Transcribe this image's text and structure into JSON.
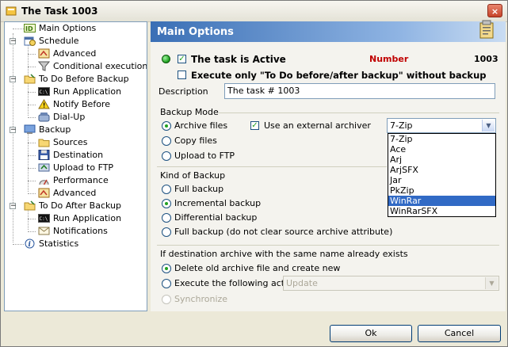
{
  "window": {
    "title": "The Task 1003",
    "close_glyph": "×"
  },
  "tree": {
    "items": [
      {
        "label": "Main Options",
        "icon": "id-card-icon"
      },
      {
        "label": "Schedule",
        "icon": "schedule-icon"
      },
      {
        "label": "Advanced",
        "icon": "advanced-icon"
      },
      {
        "label": "Conditional execution",
        "icon": "filter-icon"
      },
      {
        "label": "To Do Before Backup",
        "icon": "folder-icon"
      },
      {
        "label": "Run Application",
        "icon": "console-icon"
      },
      {
        "label": "Notify Before",
        "icon": "warning-icon"
      },
      {
        "label": "Dial-Up",
        "icon": "phone-icon"
      },
      {
        "label": "Backup",
        "icon": "backup-icon"
      },
      {
        "label": "Sources",
        "icon": "folder-icon"
      },
      {
        "label": "Destination",
        "icon": "disk-icon"
      },
      {
        "label": "Upload to FTP",
        "icon": "ftp-icon"
      },
      {
        "label": "Performance",
        "icon": "performance-icon"
      },
      {
        "label": "Advanced",
        "icon": "advanced-icon"
      },
      {
        "label": "To Do After Backup",
        "icon": "folder-icon"
      },
      {
        "label": "Run Application",
        "icon": "console-icon"
      },
      {
        "label": "Notifications",
        "icon": "mail-icon"
      },
      {
        "label": "Statistics",
        "icon": "info-icon"
      }
    ],
    "expanders": [
      "−",
      "−",
      "−",
      "−",
      "−"
    ]
  },
  "panel": {
    "header": "Main Options",
    "task_active_label": "The task is Active",
    "number_label": "Number",
    "number_value": "1003",
    "execute_only_label": "Execute only \"To Do before/after backup\" without backup",
    "description_label": "Description",
    "description_value": "The task # 1003",
    "backup_mode": {
      "title": "Backup Mode",
      "archive_files": "Archive files",
      "use_external": "Use an external archiver",
      "copy_files": "Copy files",
      "upload_ftp": "Upload to FTP",
      "archiver_selected": "7-Zip",
      "archiver_options": [
        "7-Zip",
        "Ace",
        "Arj",
        "ArjSFX",
        "Jar",
        "PkZip",
        "WinRar",
        "WinRarSFX"
      ]
    },
    "kind": {
      "title": "Kind of Backup",
      "options": [
        "Full backup",
        "Incremental backup",
        "Differential backup",
        "Full backup (do not clear source archive attribute)"
      ]
    },
    "existing": {
      "title": "If destination archive with the same name already exists",
      "delete_old": "Delete old archive file and create new",
      "execute_action": "Execute the following action",
      "action_value": "Update",
      "synchronize": "Synchronize"
    }
  },
  "buttons": {
    "ok": "Ok",
    "cancel": "Cancel"
  },
  "colors": {
    "number_label": "#c00000",
    "selection": "#316ac5",
    "header_start": "#3a6fb5"
  }
}
